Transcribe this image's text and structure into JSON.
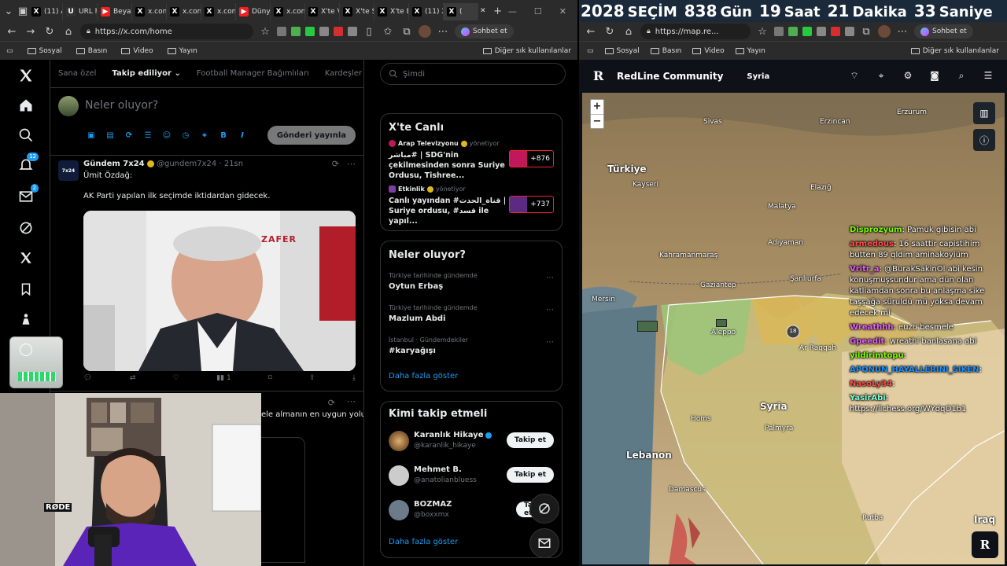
{
  "left_browser": {
    "tabs": [
      {
        "label": "(11) A",
        "icon": "x-icon"
      },
      {
        "label": "URL h",
        "icon": "link-icon"
      },
      {
        "label": "Beyaz",
        "icon": "youtube-icon"
      },
      {
        "label": "x.con",
        "icon": "x-icon"
      },
      {
        "label": "x.con",
        "icon": "x-icon"
      },
      {
        "label": "x.con",
        "icon": "x-icon"
      },
      {
        "label": "Düny",
        "icon": "youtube-icon"
      },
      {
        "label": "x.con",
        "icon": "x-icon"
      },
      {
        "label": "X'te V",
        "icon": "x-icon"
      },
      {
        "label": "X'te S",
        "icon": "x-icon"
      },
      {
        "label": "X'te E",
        "icon": "x-icon"
      },
      {
        "label": "(11) X",
        "icon": "x-icon"
      },
      {
        "label": "(",
        "icon": "x-icon"
      }
    ],
    "url": "https://x.com/home",
    "chat_button": "Sohbet et",
    "bookmarks": [
      "Sosyal",
      "Basın",
      "Video",
      "Yayın"
    ],
    "other_bookmarks": "Diğer sık kullanılanlar"
  },
  "x": {
    "sidebar": {
      "notifications_badge": "12",
      "messages_badge": "2"
    },
    "nav_tabs": [
      "Sana özel",
      "Takip ediliyor",
      "Football Manager Bağımlıları",
      "Kardeşler Kıraa"
    ],
    "compose": {
      "placeholder": "Neler oluyor?",
      "post_button": "Gönderi yayınla"
    },
    "tweet": {
      "name": "Gündem 7x24",
      "handle": "@gundem7x24",
      "time": "· 21sn",
      "line1": "Ümit Özdağ:",
      "line2": "AK Parti yapılan ilk seçimde iktidardan gidecek.",
      "views": "1",
      "image_text": "ZAFER"
    },
    "tweet2_text": "ele almanın en uygun yolu",
    "search_placeholder": "Şimdi",
    "live": {
      "title": "X'te Canlı",
      "items": [
        {
          "channel": "Arap Televizyonu",
          "role": "yönetiyor",
          "text": "مباشر# | SDG'nin çekilmesinden sonra Suriye Ordusu, Tishree...",
          "count": "+876"
        },
        {
          "channel": "Etkinlik",
          "role": "yönetiyor",
          "text": "Canlı yayından #قناة_الحدث | Suriye ordusu, #قسد ile yapıl...",
          "count": "+737"
        }
      ]
    },
    "trends": {
      "title": "Neler oluyor?",
      "items": [
        {
          "context": "Türkiye tarihinde gündemde",
          "name": "Oytun Erbaş"
        },
        {
          "context": "Türkiye tarihinde gündemde",
          "name": "Mazlum Abdi"
        },
        {
          "context": "İstanbul · Gündemdekiler",
          "name": "#karyağışı"
        }
      ],
      "more": "Daha fazla göster"
    },
    "who_to_follow": {
      "title": "Kimi takip etmeli",
      "items": [
        {
          "name": "Karanlık Hikaye",
          "handle": "@karanlik_hikaye",
          "button": "Takip et"
        },
        {
          "name": "Mehmet B.",
          "handle": "@anatolianbluess",
          "button": "Takip et"
        },
        {
          "name": "BOZMAZ",
          "handle": "@boxxmx",
          "button": "Takip et"
        }
      ],
      "more": "Daha fazla göster"
    }
  },
  "webcam": {
    "mic_brand": "RØDE"
  },
  "countdown": {
    "year": "2028",
    "label": "SEÇİM",
    "days": "838",
    "days_unit": "Gün",
    "hours": "19",
    "hours_unit": "Saat",
    "minutes": "21",
    "minutes_unit": "Dakika",
    "seconds": "33",
    "seconds_unit": "Saniye"
  },
  "right_browser": {
    "url": "https://map.re...",
    "chat_button": "Sohbet et",
    "bookmarks": [
      "Sosyal",
      "Basın",
      "Video",
      "Yayın"
    ],
    "other_bookmarks": "Diğer sık kullanılanlar"
  },
  "redline": {
    "logo": "R",
    "title": "RedLine Community",
    "section": "Syria",
    "zoom_in": "+",
    "zoom_out": "−",
    "marker_count": "18",
    "labels": {
      "turkiye": "Türkiye",
      "syria": "Syria",
      "lebanon": "Lebanon",
      "iraq": "Iraq",
      "sivas": "Sivas",
      "erzincan": "Erzincan",
      "erzurum": "Erzurum",
      "kayseri": "Kayseri",
      "elazig": "Elazığ",
      "malatya": "Malatya",
      "adiyaman": "Adıyaman",
      "kahramanmaras": "Kahramanmaraş",
      "gaziantep": "Gaziantep",
      "sanliurfa": "Şanlıurfa",
      "mersin": "Mersin",
      "aleppo": "Aleppo",
      "ar_raqqah": "Ar Raqqah",
      "homs": "Homs",
      "palmyra": "Palmyra",
      "damascus": "Damascus",
      "rutba": "Rutba"
    }
  },
  "chat": [
    {
      "user": "Disprozyum",
      "color": "#7CFC00",
      "text": "Pamuk gibisin abi"
    },
    {
      "user": "armedous",
      "color": "#ff4d4d",
      "text": "16 saattir capistihim butten 89 qldim aminakoyiüm"
    },
    {
      "user": "Vritr_a",
      "color": "#e85dff",
      "text": "@BurakSakinOl abi kesin konuşmuşsundur ama dün olan katliamdan sonra bu anlaşma sike taşşağa süruldü mü yoksa devam edecek mi"
    },
    {
      "user": "Wreathhh",
      "color": "#e85dff",
      "text": "euzu besmele"
    },
    {
      "user": "Gpeedit",
      "color": "#e85dff",
      "text": "wreathi banlasana abi"
    },
    {
      "user": "yildirimtopu",
      "color": "#7CFC00",
      "text": ""
    },
    {
      "user": "APONUN_HAYALLERINI_SIKEN",
      "color": "#1e90ff",
      "text": ""
    },
    {
      "user": "NasoLy34",
      "color": "#ff4d4d",
      "text": ""
    },
    {
      "user": "YasirAbi",
      "color": "#7fffd4",
      "text": "https://lichess.org/WYdqO1b1"
    }
  ]
}
